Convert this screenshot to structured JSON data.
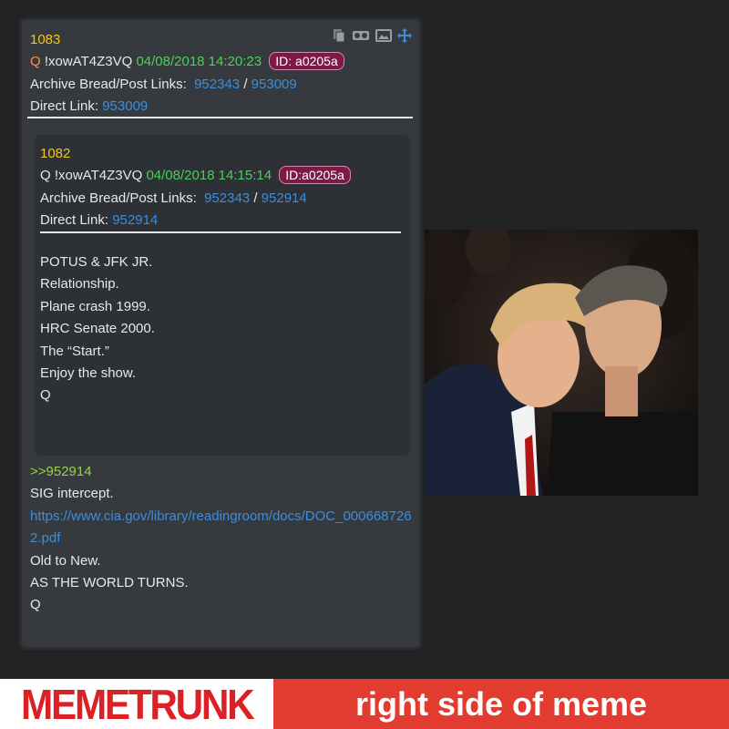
{
  "post": {
    "number": "1083",
    "q": "Q",
    "tripcode": "!xowAT4Z3VQ",
    "datetime": "04/08/2018 14:20:23",
    "id_badge": "ID: a0205a",
    "archive_label": "Archive Bread/Post Links:",
    "archive_link_1": "952343",
    "sep": "/",
    "archive_link_2": "953009",
    "direct_label": "Direct Link:",
    "direct_link": "953009",
    "reply_ref": ">>952914",
    "body_lines": [
      "SIG intercept."
    ],
    "url": "https://www.cia.gov/library/readingroom/docs/DOC_0006687262.pdf",
    "body_lines_after": [
      "Old to New.",
      "AS THE WORLD TURNS.",
      "Q"
    ]
  },
  "quoted": {
    "number": "1082",
    "q": "Q",
    "tripcode": "!xowAT4Z3VQ",
    "datetime": "04/08/2018 14:15:14",
    "id_badge": "ID:a0205a",
    "archive_label": "Archive Bread/Post Links:",
    "archive_link_1": "952343",
    "sep": "/",
    "archive_link_2": "952914",
    "direct_label": "Direct Link:",
    "direct_link": "952914",
    "body_lines": [
      "POTUS & JFK JR.",
      "Relationship.",
      "Plane crash 1999.",
      "HRC Senate 2000.",
      "The “Start.”",
      "Enjoy the show.",
      "Q"
    ]
  },
  "icons": [
    "copy-icon",
    "vr-glasses-icon",
    "image-icon",
    "move-icon"
  ],
  "banner": {
    "brand": "MEMETRUNK",
    "tagline": "right side of meme"
  },
  "colors": {
    "background": "#232323",
    "card": "#363a3f",
    "quote_card": "#2d3035",
    "post_number": "#f5c518",
    "datetime": "#4ad05a",
    "link": "#3c8ddc",
    "greentext": "#93d445",
    "id_badge": "#7b1a47",
    "brand_red": "#d92126",
    "tagline_bg": "#e23b2f"
  }
}
